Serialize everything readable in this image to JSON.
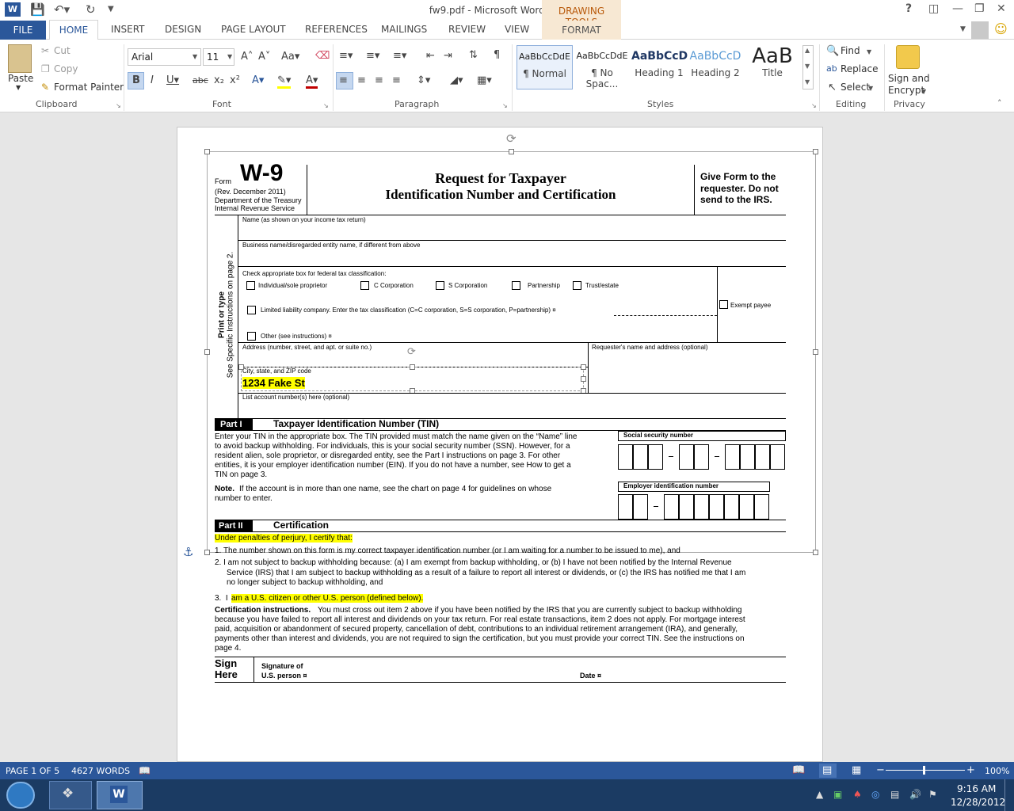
{
  "window": {
    "title": "fw9.pdf - Microsoft Word Preview",
    "drawing_tools": "DRAWING TOOLS",
    "help": "?",
    "logo": "W"
  },
  "tabs": [
    "FILE",
    "HOME",
    "INSERT",
    "DESIGN",
    "PAGE LAYOUT",
    "REFERENCES",
    "MAILINGS",
    "REVIEW",
    "VIEW",
    "FORMAT"
  ],
  "clipboard": {
    "paste": "Paste",
    "cut": "Cut",
    "copy": "Copy",
    "format_painter": "Format Painter",
    "group": "Clipboard"
  },
  "font": {
    "name": "Arial",
    "size": "11",
    "group": "Font"
  },
  "paragraph": {
    "group": "Paragraph"
  },
  "styles": {
    "items": [
      {
        "preview": "AaBbCcDdE",
        "name": "¶ Normal"
      },
      {
        "preview": "AaBbCcDdE",
        "name": "¶ No Spac..."
      },
      {
        "preview": "AaBbCcD",
        "name": "Heading 1"
      },
      {
        "preview": "AaBbCcD",
        "name": "Heading 2"
      },
      {
        "preview": "AaB",
        "name": "Title"
      }
    ],
    "group": "Styles"
  },
  "editing": {
    "find": "Find",
    "replace": "Replace",
    "select": "Select",
    "group": "Editing"
  },
  "privacy": {
    "sign": "Sign and",
    "encrypt": "Encrypt",
    "group": "Privacy"
  },
  "form": {
    "form_label": "Form",
    "form_number": "W-9",
    "rev": "(Rev. December 2011)",
    "dept": "Department of the Treasury",
    "irs": "Internal Revenue Service",
    "title1": "Request for Taxpayer",
    "title2": "Identification Number and Certification",
    "give1": "Give Form to the",
    "give2": "requester. Do not",
    "give3": "send to the IRS.",
    "name_label": "Name (as shown on your income tax return)",
    "business_label": "Business name/disregarded entity name, if different from above",
    "check_label": "Check appropriate box for federal tax classification:",
    "cb_individual": "Individual/sole proprietor",
    "cb_ccorp": "C Corporation",
    "cb_scorp": "S Corporation",
    "cb_partnership": "Partnership",
    "cb_trust": "Trust/estate",
    "cb_llc": "Limited liability company. Enter the tax classification (C=C corporation, S=S corporation, P=partnership) ¤",
    "cb_exempt": "Exempt payee",
    "cb_other": "Other (see instructions) ¤",
    "side1": "Print or type",
    "side2": "See Specific Instructions on page 2.",
    "address_label": "Address (number, street, and apt. or suite no.)",
    "requester_label": "Requester's name and address (optional)",
    "city_label": "City, state, and ZIP code",
    "textbox_value": "1234 Fake St",
    "account_label": "List account number(s) here (optional)",
    "part1": "Part I",
    "part1_title": "Taxpayer Identification Number (TIN)",
    "tin_p1": "Enter your TIN in the appropriate box. The TIN provided must match the name given on the “Name” line",
    "tin_p2": "to avoid backup withholding. For individuals, this is your social security number (SSN). However, for a",
    "tin_p3": "resident alien, sole proprietor, or disregarded entity, see the Part I instructions on page 3. For other",
    "tin_p4": "entities, it is your employer identification number (EIN). If you do not have a number, see How to get a",
    "tin_p5": "TIN on page 3.",
    "note_b": "Note.",
    "note_1": "If the account is in more than one name, see the chart on page 4 for guidelines on whose",
    "note_2": "number to enter.",
    "ssn_label": "Social security number",
    "ein_label": "Employer identification number",
    "part2": "Part II",
    "part2_title": "Certification",
    "penalties": "Under penalties of perjury, I certify that:",
    "item1": "1.  The number shown on this form is my correct taxpayer identification number (or I am waiting for a number to be issued to me), and",
    "item2a": "2.  I am not subject to backup withholding because: (a) I am exempt from backup withholding, or (b) I have not been notified by the Internal Revenue",
    "item2b": "Service (IRS) that I am subject to backup withholding as a result of a failure to report all interest or dividends, or (c) the IRS has notified me that I am",
    "item2c": "no longer subject to backup withholding, and",
    "item3_pre": "3.  I ",
    "item3_hl": "am a U.S. citizen or other U.S. person (defined below).",
    "cert_b": "Certification instructions.",
    "cert1": "You must cross out item 2 above if you have been notified by the IRS that you are currently subject to backup withholding",
    "cert2": "because you have failed to report all interest and dividends on your tax return. For real estate transactions, item 2 does not apply. For mortgage interest",
    "cert3": "paid, acquisition or abandonment of secured property, cancellation of debt, contributions to an individual retirement arrangement (IRA), and generally,",
    "cert4": "payments other than interest and dividends, you are not required to sign the certification, but you must provide your correct TIN. See the instructions on",
    "cert5": "page 4.",
    "sign1": "Sign",
    "sign2": "Here",
    "sigof1": "Signature of",
    "sigof2": "U.S. person ¤",
    "date": "Date ¤"
  },
  "status": {
    "page": "PAGE 1 OF 5",
    "words": "4627 WORDS",
    "zoom": "100%"
  },
  "clock": {
    "time": "9:16 AM",
    "date": "12/28/2012"
  }
}
